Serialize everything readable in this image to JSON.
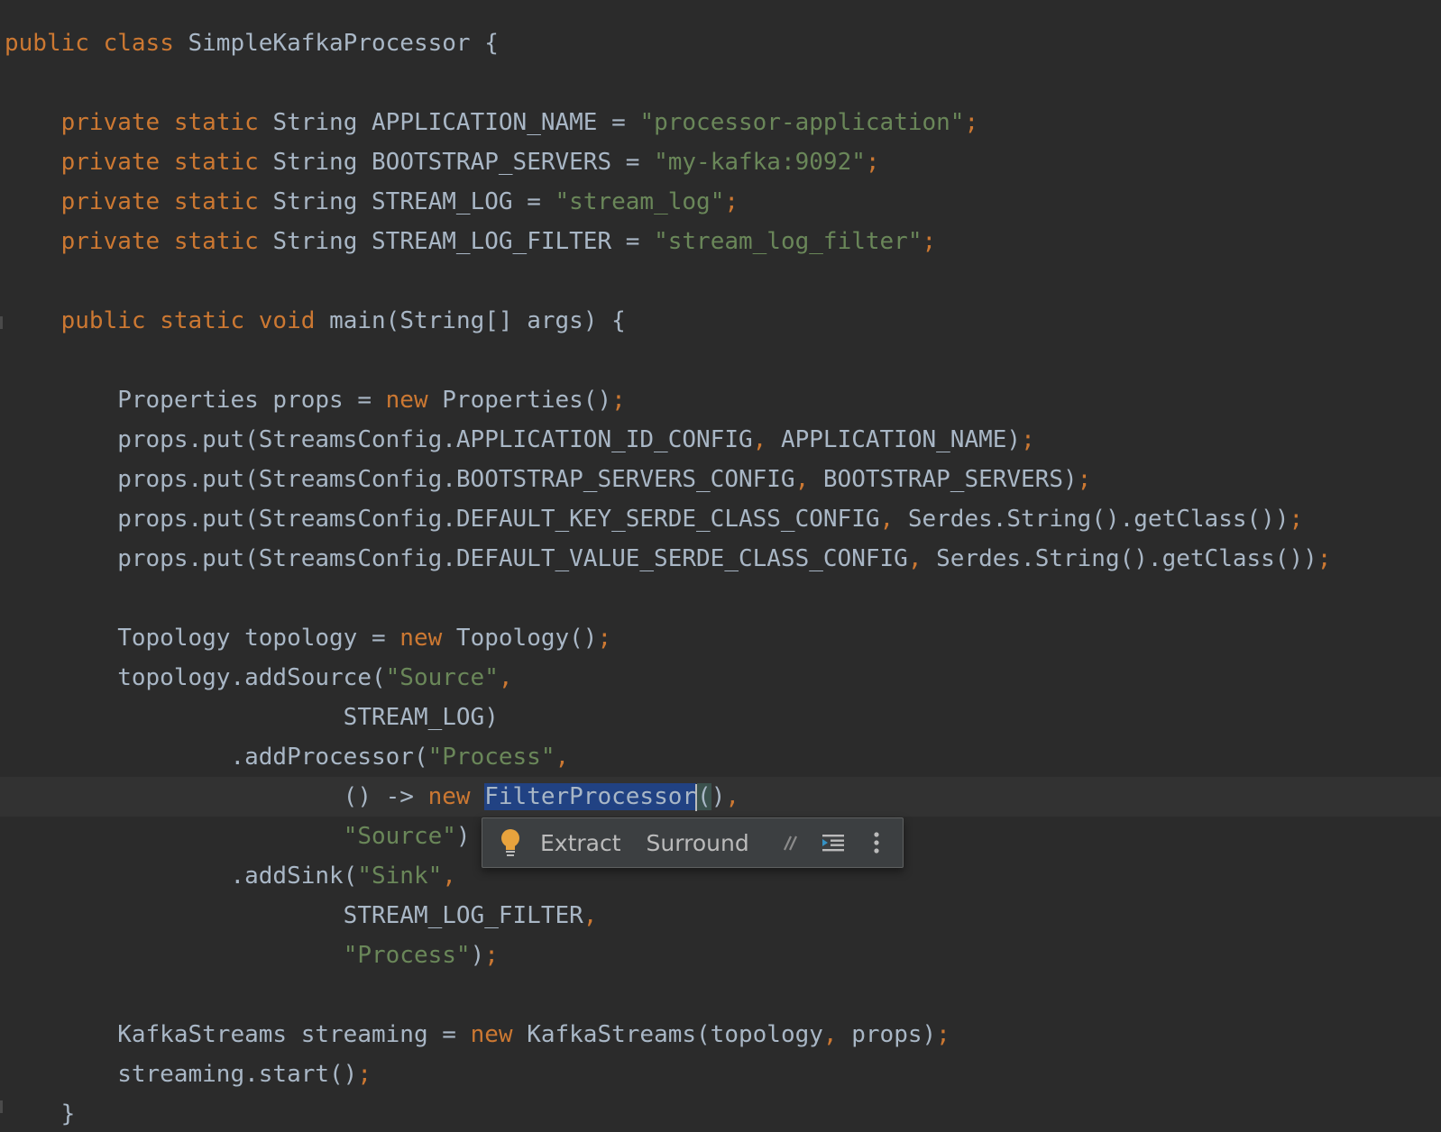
{
  "code": {
    "lines": [
      [
        [
          "kw",
          "public "
        ],
        [
          "kw",
          "class "
        ],
        [
          "plain",
          "SimpleKafkaProcessor {"
        ]
      ],
      [],
      [
        [
          "plain",
          "    "
        ],
        [
          "kw",
          "private "
        ],
        [
          "kw",
          "static "
        ],
        [
          "plain",
          "String APPLICATION_NAME = "
        ],
        [
          "str",
          "\"processor-application\""
        ],
        [
          "punct",
          ";"
        ]
      ],
      [
        [
          "plain",
          "    "
        ],
        [
          "kw",
          "private "
        ],
        [
          "kw",
          "static "
        ],
        [
          "plain",
          "String BOOTSTRAP_SERVERS = "
        ],
        [
          "str",
          "\"my-kafka:9092\""
        ],
        [
          "punct",
          ";"
        ]
      ],
      [
        [
          "plain",
          "    "
        ],
        [
          "kw",
          "private "
        ],
        [
          "kw",
          "static "
        ],
        [
          "plain",
          "String STREAM_LOG = "
        ],
        [
          "str",
          "\"stream_log\""
        ],
        [
          "punct",
          ";"
        ]
      ],
      [
        [
          "plain",
          "    "
        ],
        [
          "kw",
          "private "
        ],
        [
          "kw",
          "static "
        ],
        [
          "plain",
          "String STREAM_LOG_FILTER = "
        ],
        [
          "str",
          "\"stream_log_filter\""
        ],
        [
          "punct",
          ";"
        ]
      ],
      [],
      [
        [
          "plain",
          "    "
        ],
        [
          "kw",
          "public "
        ],
        [
          "kw",
          "static "
        ],
        [
          "kw",
          "void "
        ],
        [
          "plain",
          "main(String[] args) {"
        ]
      ],
      [],
      [
        [
          "plain",
          "        Properties props = "
        ],
        [
          "kw",
          "new "
        ],
        [
          "plain",
          "Properties()"
        ],
        [
          "punct",
          ";"
        ]
      ],
      [
        [
          "plain",
          "        props.put(StreamsConfig.APPLICATION_ID_CONFIG"
        ],
        [
          "punct",
          ", "
        ],
        [
          "plain",
          "APPLICATION_NAME)"
        ],
        [
          "punct",
          ";"
        ]
      ],
      [
        [
          "plain",
          "        props.put(StreamsConfig.BOOTSTRAP_SERVERS_CONFIG"
        ],
        [
          "punct",
          ", "
        ],
        [
          "plain",
          "BOOTSTRAP_SERVERS)"
        ],
        [
          "punct",
          ";"
        ]
      ],
      [
        [
          "plain",
          "        props.put(StreamsConfig.DEFAULT_KEY_SERDE_CLASS_CONFIG"
        ],
        [
          "punct",
          ", "
        ],
        [
          "plain",
          "Serdes.String().getClass())"
        ],
        [
          "punct",
          ";"
        ]
      ],
      [
        [
          "plain",
          "        props.put(StreamsConfig.DEFAULT_VALUE_SERDE_CLASS_CONFIG"
        ],
        [
          "punct",
          ", "
        ],
        [
          "plain",
          "Serdes.String().getClass())"
        ],
        [
          "punct",
          ";"
        ]
      ],
      [],
      [
        [
          "plain",
          "        Topology topology = "
        ],
        [
          "kw",
          "new "
        ],
        [
          "plain",
          "Topology()"
        ],
        [
          "punct",
          ";"
        ]
      ],
      [
        [
          "plain",
          "        topology.addSource("
        ],
        [
          "str",
          "\"Source\""
        ],
        [
          "punct",
          ","
        ]
      ],
      [
        [
          "plain",
          "                        STREAM_LOG)"
        ]
      ],
      [
        [
          "plain",
          "                .addProcessor("
        ],
        [
          "str",
          "\"Process\""
        ],
        [
          "punct",
          ","
        ]
      ],
      [
        [
          "plain",
          "                        () -> "
        ],
        [
          "kw",
          "new "
        ],
        [
          "sel",
          "FilterProcessor"
        ],
        [
          "caret",
          ""
        ],
        [
          "brace",
          "("
        ],
        [
          "plain",
          ")"
        ],
        [
          "punct",
          ","
        ]
      ],
      [
        [
          "plain",
          "                        "
        ],
        [
          "str",
          "\"Source\""
        ],
        [
          "plain",
          ")"
        ]
      ],
      [
        [
          "plain",
          "                .addSink("
        ],
        [
          "str",
          "\"Sink\""
        ],
        [
          "punct",
          ","
        ]
      ],
      [
        [
          "plain",
          "                        STREAM_LOG_FILTER"
        ],
        [
          "punct",
          ","
        ]
      ],
      [
        [
          "plain",
          "                        "
        ],
        [
          "str",
          "\"Process\""
        ],
        [
          "plain",
          ")"
        ],
        [
          "punct",
          ";"
        ]
      ],
      [],
      [
        [
          "plain",
          "        KafkaStreams streaming = "
        ],
        [
          "kw",
          "new "
        ],
        [
          "plain",
          "KafkaStreams(topology"
        ],
        [
          "punct",
          ", "
        ],
        [
          "plain",
          "props)"
        ],
        [
          "punct",
          ";"
        ]
      ],
      [
        [
          "plain",
          "        streaming.start()"
        ],
        [
          "punct",
          ";"
        ]
      ],
      [
        [
          "plain",
          "    }"
        ]
      ]
    ],
    "current_line_index": 19
  },
  "toolbar": {
    "bulb_icon": "lightbulb-icon",
    "extract_label": "Extract",
    "surround_label": "Surround",
    "comment_icon": "comment-icon",
    "format_icon": "reformat-icon",
    "more_icon": "more-options-icon"
  },
  "colors": {
    "background": "#2b2b2b",
    "keyword": "#cc7832",
    "string": "#6a8759",
    "plain": "#a9b7c6",
    "selection": "#214283",
    "bulb": "#e8a33d"
  }
}
